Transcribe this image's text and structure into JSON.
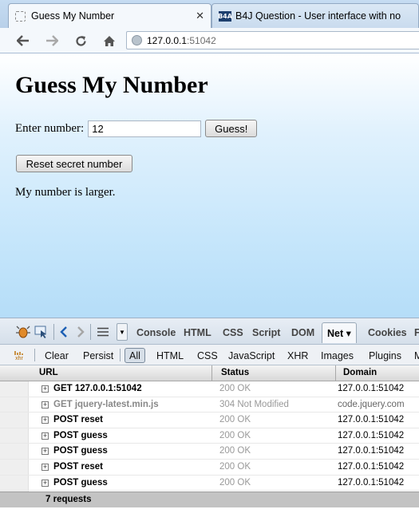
{
  "browser": {
    "tabs": [
      {
        "title": "Guess My Number",
        "active": true
      },
      {
        "title": "B4J Question - User interface with no",
        "active": false,
        "favicon_text": "B4A"
      }
    ],
    "url": {
      "host": "127.0.0.1",
      "port": ":51042"
    }
  },
  "page": {
    "heading": "Guess My Number",
    "number_label": "Enter number:",
    "number_value": "12",
    "guess_button": "Guess!",
    "reset_button": "Reset secret number",
    "message": "My number is larger."
  },
  "firebug": {
    "panels": [
      "Console",
      "HTML",
      "CSS",
      "Script",
      "DOM",
      "Net ▾",
      "Cookies",
      "F"
    ],
    "active_panel": "Net",
    "net_toolbar": {
      "xhr_icon_label": "xhr",
      "clear": "Clear",
      "persist": "Persist",
      "filters": [
        "All",
        "HTML",
        "CSS",
        "JavaScript",
        "XHR",
        "Images",
        "Plugins",
        "M"
      ]
    },
    "columns": {
      "url": "URL",
      "status": "Status",
      "domain": "Domain"
    },
    "requests": [
      {
        "url": "GET 127.0.0.1:51042",
        "status": "200 OK",
        "domain": "127.0.0.1:51042"
      },
      {
        "url": "GET jquery-latest.min.js",
        "status": "304 Not Modified",
        "domain": "code.jquery.com"
      },
      {
        "url": "POST reset",
        "status": "200 OK",
        "domain": "127.0.0.1:51042"
      },
      {
        "url": "POST guess",
        "status": "200 OK",
        "domain": "127.0.0.1:51042"
      },
      {
        "url": "POST guess",
        "status": "200 OK",
        "domain": "127.0.0.1:51042"
      },
      {
        "url": "POST reset",
        "status": "200 OK",
        "domain": "127.0.0.1:51042"
      },
      {
        "url": "POST guess",
        "status": "200 OK",
        "domain": "127.0.0.1:51042"
      }
    ],
    "summary": "7 requests"
  }
}
